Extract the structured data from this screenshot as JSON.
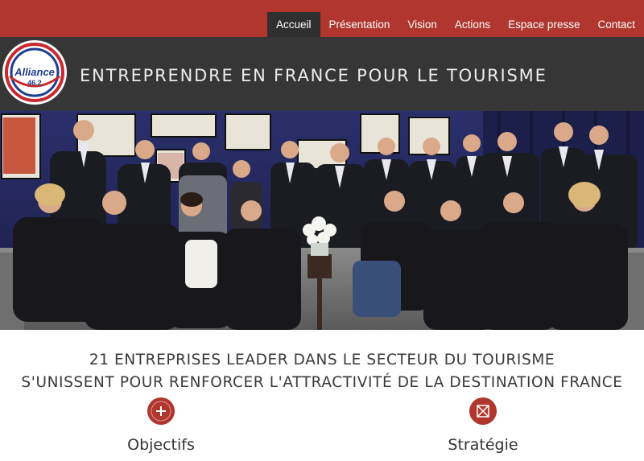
{
  "nav": {
    "items": [
      {
        "label": "Accueil",
        "active": true
      },
      {
        "label": "Présentation",
        "active": false
      },
      {
        "label": "Vision",
        "active": false
      },
      {
        "label": "Actions",
        "active": false
      },
      {
        "label": "Espace presse",
        "active": false
      },
      {
        "label": "Contact",
        "active": false
      }
    ]
  },
  "header": {
    "logo_text": "Alliance",
    "logo_number": "46.2",
    "tagline": "ENTREPRENDRE EN FRANCE POUR LE TOURISME"
  },
  "intro": {
    "line1": "21 ENTREPRISES LEADER DANS LE SECTEUR DU TOURISME",
    "line2": "S'UNISSENT POUR RENFORCER L'ATTRACTIVITÉ DE LA DESTINATION FRANCE"
  },
  "features": [
    {
      "label": "Objectifs",
      "icon": "plus-icon"
    },
    {
      "label": "Stratégie",
      "icon": "expand-arrows-icon"
    }
  ],
  "colors": {
    "brand_red": "#b0362e",
    "header_dark": "#363636",
    "nav_active": "#2f2f2f"
  }
}
